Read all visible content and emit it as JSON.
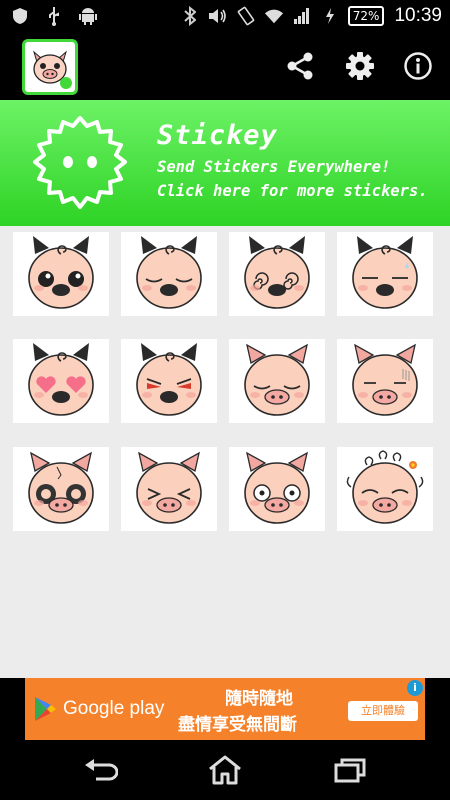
{
  "status_bar": {
    "battery": "72%",
    "time": "10:39",
    "icons": [
      "shield-icon",
      "usb-icon",
      "android-icon",
      "bluetooth-icon",
      "volume-icon",
      "rotation-icon",
      "wifi-icon",
      "signal-icon",
      "charging-icon"
    ]
  },
  "app_bar": {
    "icons": [
      "share-icon",
      "settings-icon",
      "info-icon"
    ]
  },
  "banner": {
    "title": "Stickey",
    "line1": "Send Stickers Everywhere!",
    "line2": "Click here for more stickers."
  },
  "stickers": [
    {
      "type": "cat",
      "expression": "big-eyes"
    },
    {
      "type": "cat",
      "expression": "sleepy"
    },
    {
      "type": "cat",
      "expression": "dizzy"
    },
    {
      "type": "cat",
      "expression": "annoyed"
    },
    {
      "type": "cat",
      "expression": "heart-eyes"
    },
    {
      "type": "cat",
      "expression": "angry"
    },
    {
      "type": "pig",
      "expression": "sleepy"
    },
    {
      "type": "pig",
      "expression": "shocked"
    },
    {
      "type": "pig",
      "expression": "black-eye"
    },
    {
      "type": "pig",
      "expression": "squint"
    },
    {
      "type": "pig",
      "expression": "dazed"
    },
    {
      "type": "pig-girl",
      "expression": "happy"
    }
  ],
  "ad": {
    "store": "Google play",
    "line1": "隨時隨地",
    "line2": "盡情享受無間斷",
    "cta": "立即體驗",
    "info": "i"
  },
  "nav_bar": {
    "icons": [
      "back-icon",
      "home-icon",
      "recents-icon"
    ]
  }
}
